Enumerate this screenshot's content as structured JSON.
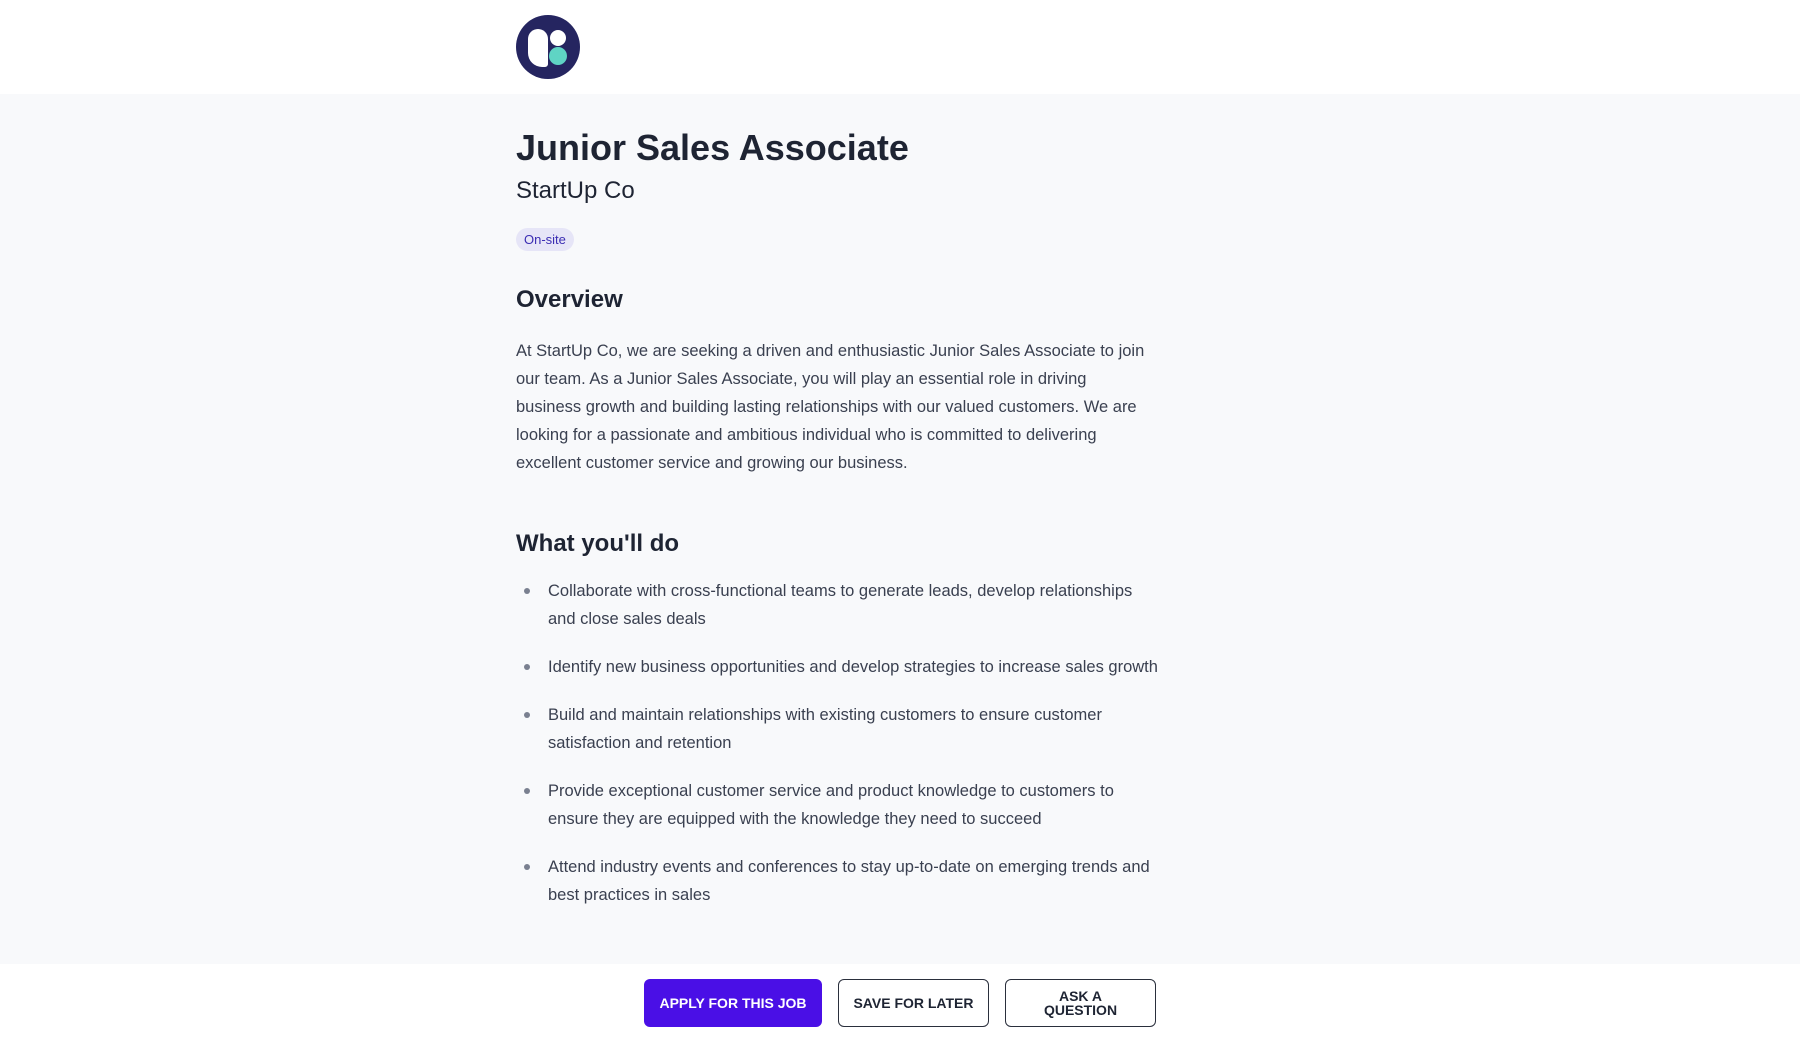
{
  "header": {
    "logo_name": "company-logo"
  },
  "job": {
    "title": "Junior Sales Associate",
    "company": "StartUp Co",
    "work_type": "On-site"
  },
  "overview": {
    "heading": "Overview",
    "text": "At StartUp Co, we are seeking a driven and enthusiastic Junior Sales Associate to join our team. As a Junior Sales Associate, you will play an essential role in driving business growth and building lasting relationships with our valued customers. We are looking for a passionate and ambitious individual who is committed to delivering excellent customer service and growing our business."
  },
  "duties": {
    "heading": "What you'll do",
    "items": [
      "Collaborate with cross-functional teams to generate leads, develop relationships and close sales deals",
      "Identify new business opportunities and develop strategies to increase sales growth",
      "Build and maintain relationships with existing customers to ensure customer satisfaction and retention",
      "Provide exceptional customer service and product knowledge to customers to ensure they are equipped with the knowledge they need to succeed",
      "Attend industry events and conferences to stay up-to-date on emerging trends and best practices in sales"
    ]
  },
  "actions": {
    "apply_label": "Apply for this job",
    "save_label": "Save for later",
    "ask_label": "Ask a question"
  },
  "colors": {
    "accent": "#4a0fe6",
    "logo_bg": "#252560",
    "logo_dot": "#5fd4c4",
    "badge_bg": "#e6e5f7",
    "badge_text": "#3b2db3"
  }
}
